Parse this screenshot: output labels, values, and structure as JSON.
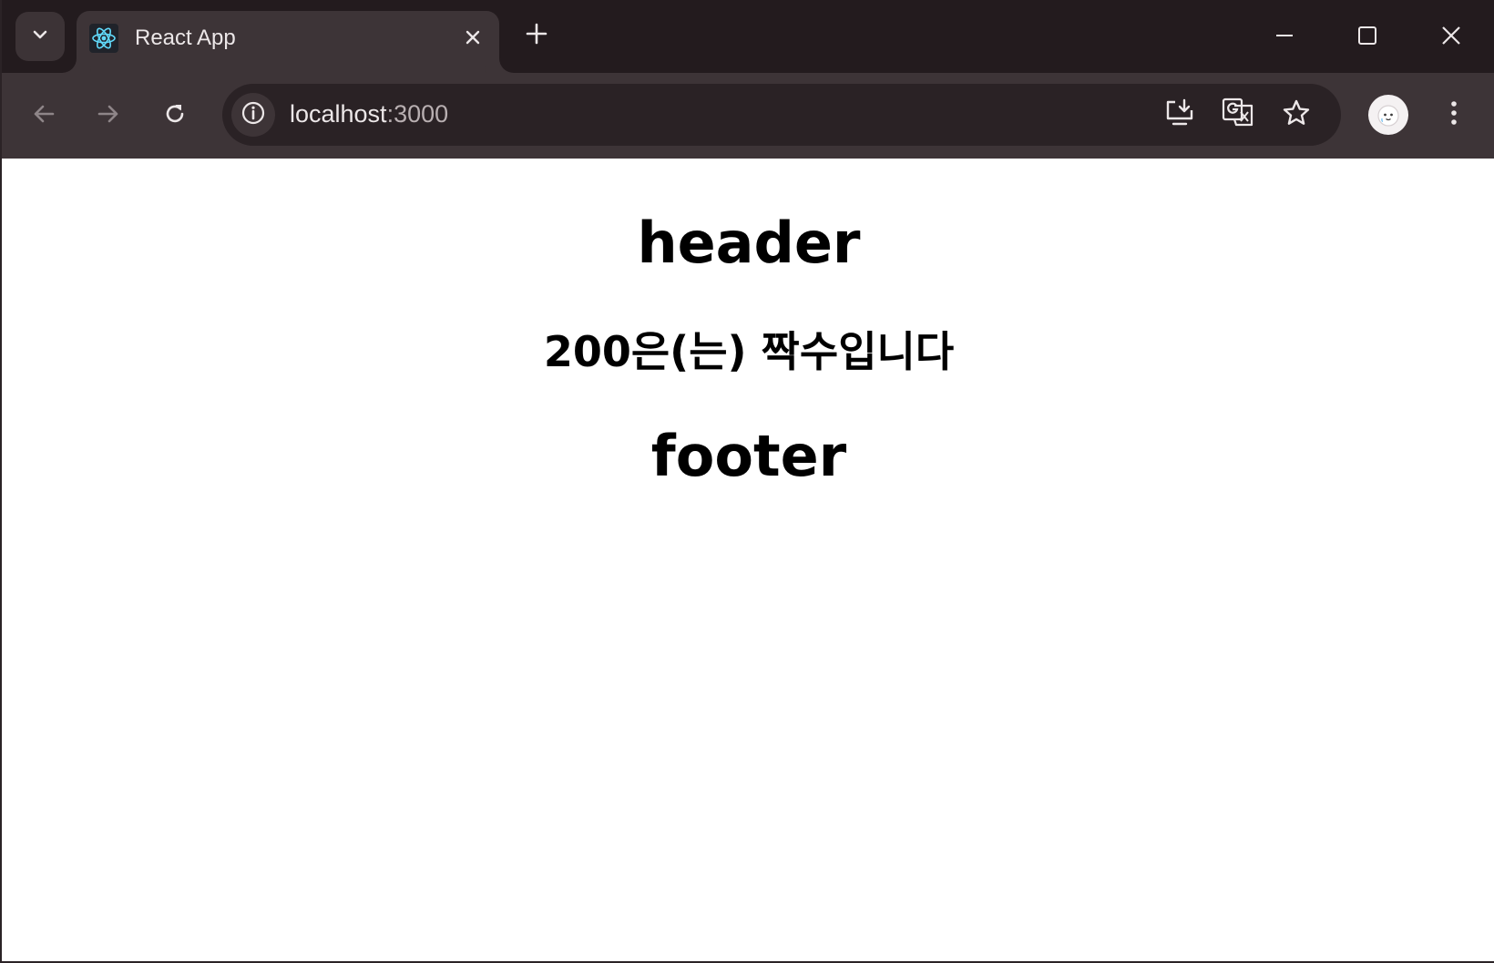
{
  "browser": {
    "tab": {
      "title": "React App",
      "favicon": "react-logo-icon"
    },
    "address_bar": {
      "host": "localhost",
      "port": ":3000"
    },
    "icons": {
      "tab_search": "chevron-down-icon",
      "close_tab": "close-icon",
      "new_tab": "plus-icon",
      "minimize": "minimize-icon",
      "maximize": "maximize-icon",
      "close_window": "close-icon",
      "back": "arrow-left-icon",
      "forward": "arrow-right-icon",
      "reload": "reload-icon",
      "site_info": "info-icon",
      "install": "install-app-icon",
      "translate": "translate-icon",
      "bookmark": "star-icon",
      "profile": "avatar",
      "menu": "kebab-menu-icon"
    },
    "colors": {
      "tab_strip": "#231b1e",
      "toolbar": "#3d3437",
      "omnibox": "#2a2225",
      "react_blue": "#61dafb"
    }
  },
  "page": {
    "header": "header",
    "message": "200은(는) 짝수입니다",
    "footer": "footer"
  }
}
